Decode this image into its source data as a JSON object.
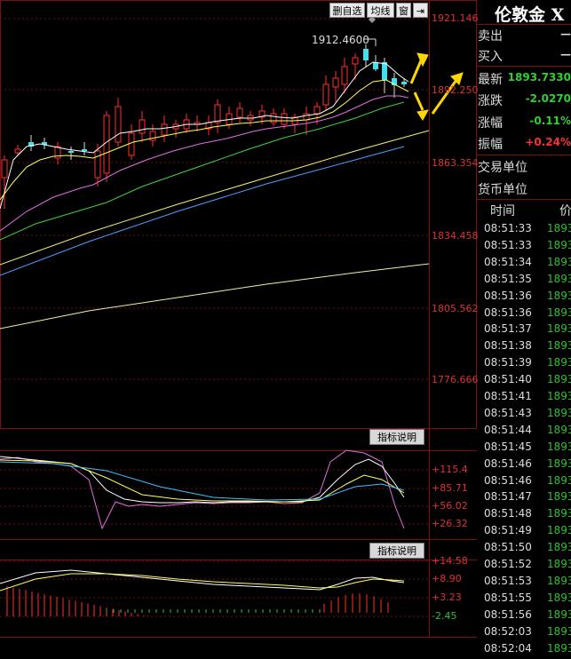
{
  "toolbar": {
    "delete_watch": "删自选",
    "ma_lines": "均线",
    "window": "窗",
    "collapse": "⇥"
  },
  "main_chart": {
    "y_labels": [
      "1921.146",
      "1892.250",
      "1863.354",
      "1834.458",
      "1805.562",
      "1776.666"
    ],
    "peak_annotation": "1912.4600"
  },
  "indicator1": {
    "button": "指标说明",
    "labels": [
      "+115.4",
      "+85.71",
      "+56.02",
      "+26.32"
    ]
  },
  "indicator2": {
    "button": "指标说明",
    "labels": [
      "+14.58",
      "+8.90",
      "+3.23",
      "-2.45"
    ]
  },
  "panel": {
    "title": "伦敦金 X",
    "sell_label": "卖出",
    "sell_value": "—",
    "buy_label": "买入",
    "buy_value": "—",
    "latest_label": "最新",
    "latest_value": "1893.7330",
    "change_label": "涨跌",
    "change_value": "-2.0270",
    "pct_label": "涨幅",
    "pct_value": "-0.11%",
    "amp_label": "振幅",
    "amp_value": "+0.24%",
    "unit_label": "交易单位",
    "currency_label": "货币单位",
    "col_time": "时间",
    "col_price": "价"
  },
  "ticks": [
    {
      "time": "08:51:33",
      "price": "1893"
    },
    {
      "time": "08:51:33",
      "price": "1893"
    },
    {
      "time": "08:51:34",
      "price": "1893"
    },
    {
      "time": "08:51:35",
      "price": "1893"
    },
    {
      "time": "08:51:36",
      "price": "1893"
    },
    {
      "time": "08:51:36",
      "price": "1893"
    },
    {
      "time": "08:51:37",
      "price": "1893"
    },
    {
      "time": "08:51:38",
      "price": "1893"
    },
    {
      "time": "08:51:39",
      "price": "1893"
    },
    {
      "time": "08:51:40",
      "price": "1893"
    },
    {
      "time": "08:51:41",
      "price": "1893"
    },
    {
      "time": "08:51:43",
      "price": "1893"
    },
    {
      "time": "08:51:44",
      "price": "1893"
    },
    {
      "time": "08:51:45",
      "price": "1893"
    },
    {
      "time": "08:51:46",
      "price": "1893"
    },
    {
      "time": "08:51:46",
      "price": "1893"
    },
    {
      "time": "08:51:47",
      "price": "1893"
    },
    {
      "time": "08:51:48",
      "price": "1893"
    },
    {
      "time": "08:51:49",
      "price": "1893"
    },
    {
      "time": "08:51:50",
      "price": "1893"
    },
    {
      "time": "08:51:52",
      "price": "1893"
    },
    {
      "time": "08:51:53",
      "price": "1893"
    },
    {
      "time": "08:51:55",
      "price": "1893"
    },
    {
      "time": "08:51:56",
      "price": "1893"
    },
    {
      "time": "08:52:03",
      "price": "1893"
    },
    {
      "time": "08:52:04",
      "price": "1893"
    }
  ],
  "colors": {
    "up": "#ff3030",
    "down": "#40e0f0",
    "grid": "#7a1010",
    "arrow": "#ffd700"
  }
}
